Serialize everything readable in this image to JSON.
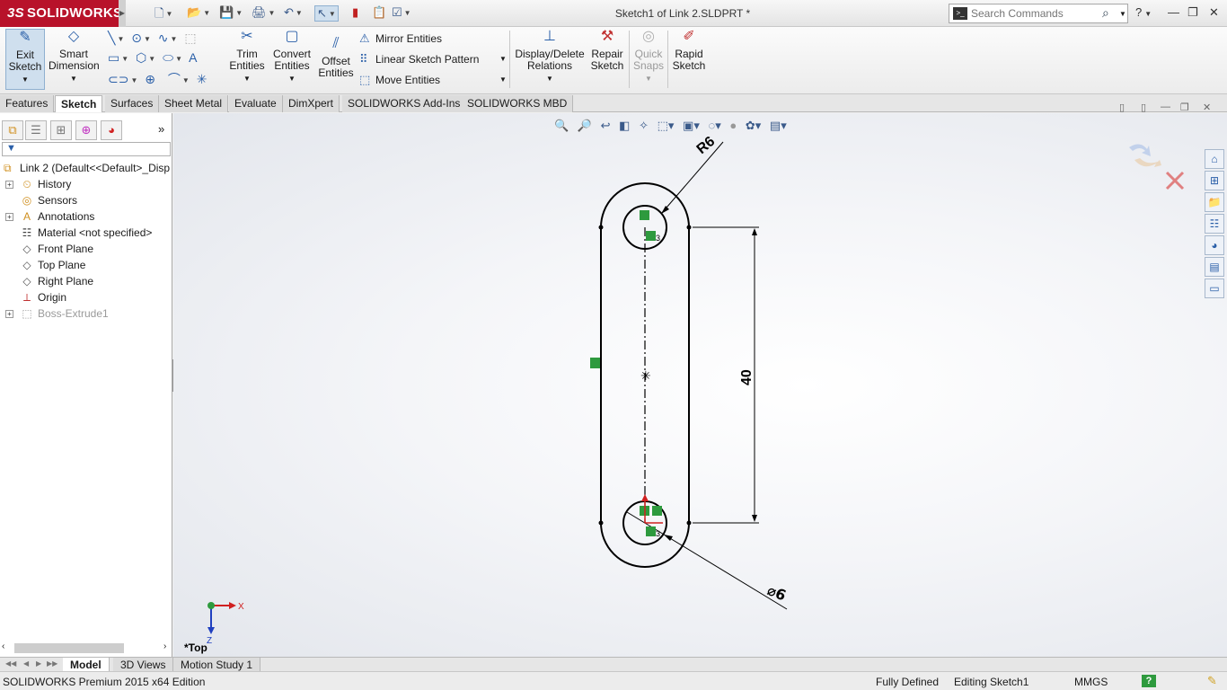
{
  "app": {
    "brand_prefix": "3S",
    "brand": "SOLIDWORKS",
    "document_title": "Sketch1 of Link 2.SLDPRT *"
  },
  "search": {
    "placeholder": "Search Commands"
  },
  "ribbon": {
    "exit_sketch": [
      "Exit",
      "Sketch"
    ],
    "smart_dimension": [
      "Smart",
      "Dimension"
    ],
    "trim_entities": [
      "Trim",
      "Entities"
    ],
    "convert_entities": [
      "Convert",
      "Entities"
    ],
    "offset_entities": [
      "Offset",
      "Entities"
    ],
    "mirror_entities": "Mirror Entities",
    "linear_sketch_pattern": "Linear Sketch Pattern",
    "move_entities": "Move Entities",
    "display_delete_relations": [
      "Display/Delete",
      "Relations"
    ],
    "repair_sketch": [
      "Repair",
      "Sketch"
    ],
    "quick_snaps": [
      "Quick",
      "Snaps"
    ],
    "rapid_sketch": [
      "Rapid",
      "Sketch"
    ]
  },
  "tabs": [
    {
      "label": "Features",
      "active": false
    },
    {
      "label": "Sketch",
      "active": true
    },
    {
      "label": "Surfaces",
      "active": false
    },
    {
      "label": "Sheet Metal",
      "active": false
    },
    {
      "label": "Evaluate",
      "active": false
    },
    {
      "label": "DimXpert",
      "active": false
    },
    {
      "label": "SOLIDWORKS Add-Ins",
      "active": false
    },
    {
      "label": "SOLIDWORKS MBD",
      "active": false
    }
  ],
  "feature_tree": {
    "root": "Link 2  (Default<<Default>_Disp",
    "items": [
      {
        "label": "History",
        "icon": "history-icon",
        "expandable": true
      },
      {
        "label": "Sensors",
        "icon": "sensors-icon",
        "expandable": false
      },
      {
        "label": "Annotations",
        "icon": "annotations-icon",
        "expandable": true
      },
      {
        "label": "Material <not specified>",
        "icon": "material-icon",
        "expandable": false
      },
      {
        "label": "Front Plane",
        "icon": "plane-icon",
        "expandable": false
      },
      {
        "label": "Top Plane",
        "icon": "plane-icon",
        "expandable": false
      },
      {
        "label": "Right Plane",
        "icon": "plane-icon",
        "expandable": false
      },
      {
        "label": "Origin",
        "icon": "origin-icon",
        "expandable": false
      },
      {
        "label": "Boss-Extrude1",
        "icon": "extrude-icon",
        "expandable": true,
        "greyed": true
      }
    ]
  },
  "sketch": {
    "dim_radius": "R6",
    "dim_length": "40",
    "dim_diameter": "⌀6",
    "relation_count": "3"
  },
  "triad": {
    "x": "X",
    "z": "Z"
  },
  "view_label": "*Top",
  "bottom_tabs": [
    {
      "label": "Model",
      "active": true
    },
    {
      "label": "3D Views",
      "active": false
    },
    {
      "label": "Motion Study 1",
      "active": false
    }
  ],
  "status": {
    "edition": "SOLIDWORKS Premium 2015 x64 Edition",
    "state": "Fully Defined",
    "editing": "Editing Sketch1",
    "units": "MMGS",
    "help": "?"
  },
  "colors": {
    "brand_red": "#b8122a",
    "accent_blue": "#2a5fa8",
    "relation_green": "#2e9a3e"
  }
}
